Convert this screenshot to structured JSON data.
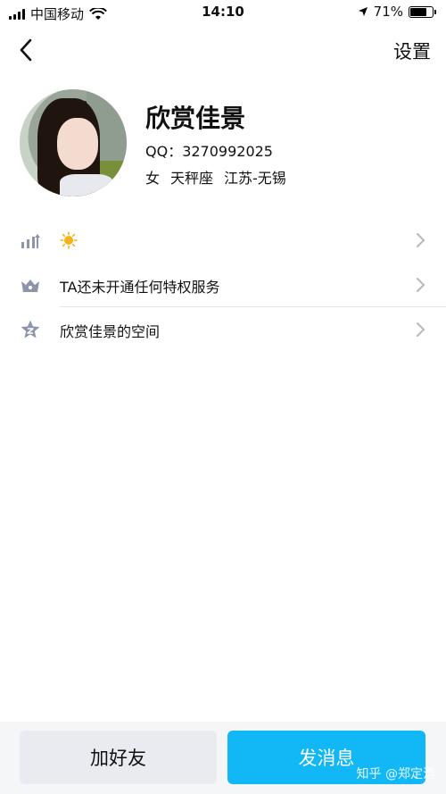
{
  "status_bar": {
    "carrier": "中国移动",
    "time": "14:10",
    "battery": "71%",
    "battery_level": 0.71
  },
  "nav": {
    "back_icon": "chevron-left-icon",
    "settings_label": "设置"
  },
  "profile": {
    "nickname": "欣赏佳景",
    "qq": "QQ：3270992025",
    "gender": "女",
    "zodiac": "天秤座",
    "location": "江苏-无锡"
  },
  "list": {
    "items": [
      {
        "icon": "level-up-icon",
        "label": "",
        "badge_icon": "sun-icon"
      },
      {
        "icon": "crown-icon",
        "label": "TA还未开通任何特权服务"
      },
      {
        "icon": "star-z-icon",
        "label": "欣赏佳景的空间"
      }
    ]
  },
  "actions": {
    "add_friend": "加好友",
    "send_message": "发消息"
  },
  "watermark": "知乎 @郑定浩",
  "colors": {
    "accent": "#12b7f5",
    "secondary_button": "#e9ebf0",
    "icon_gray": "#8f95a8"
  }
}
